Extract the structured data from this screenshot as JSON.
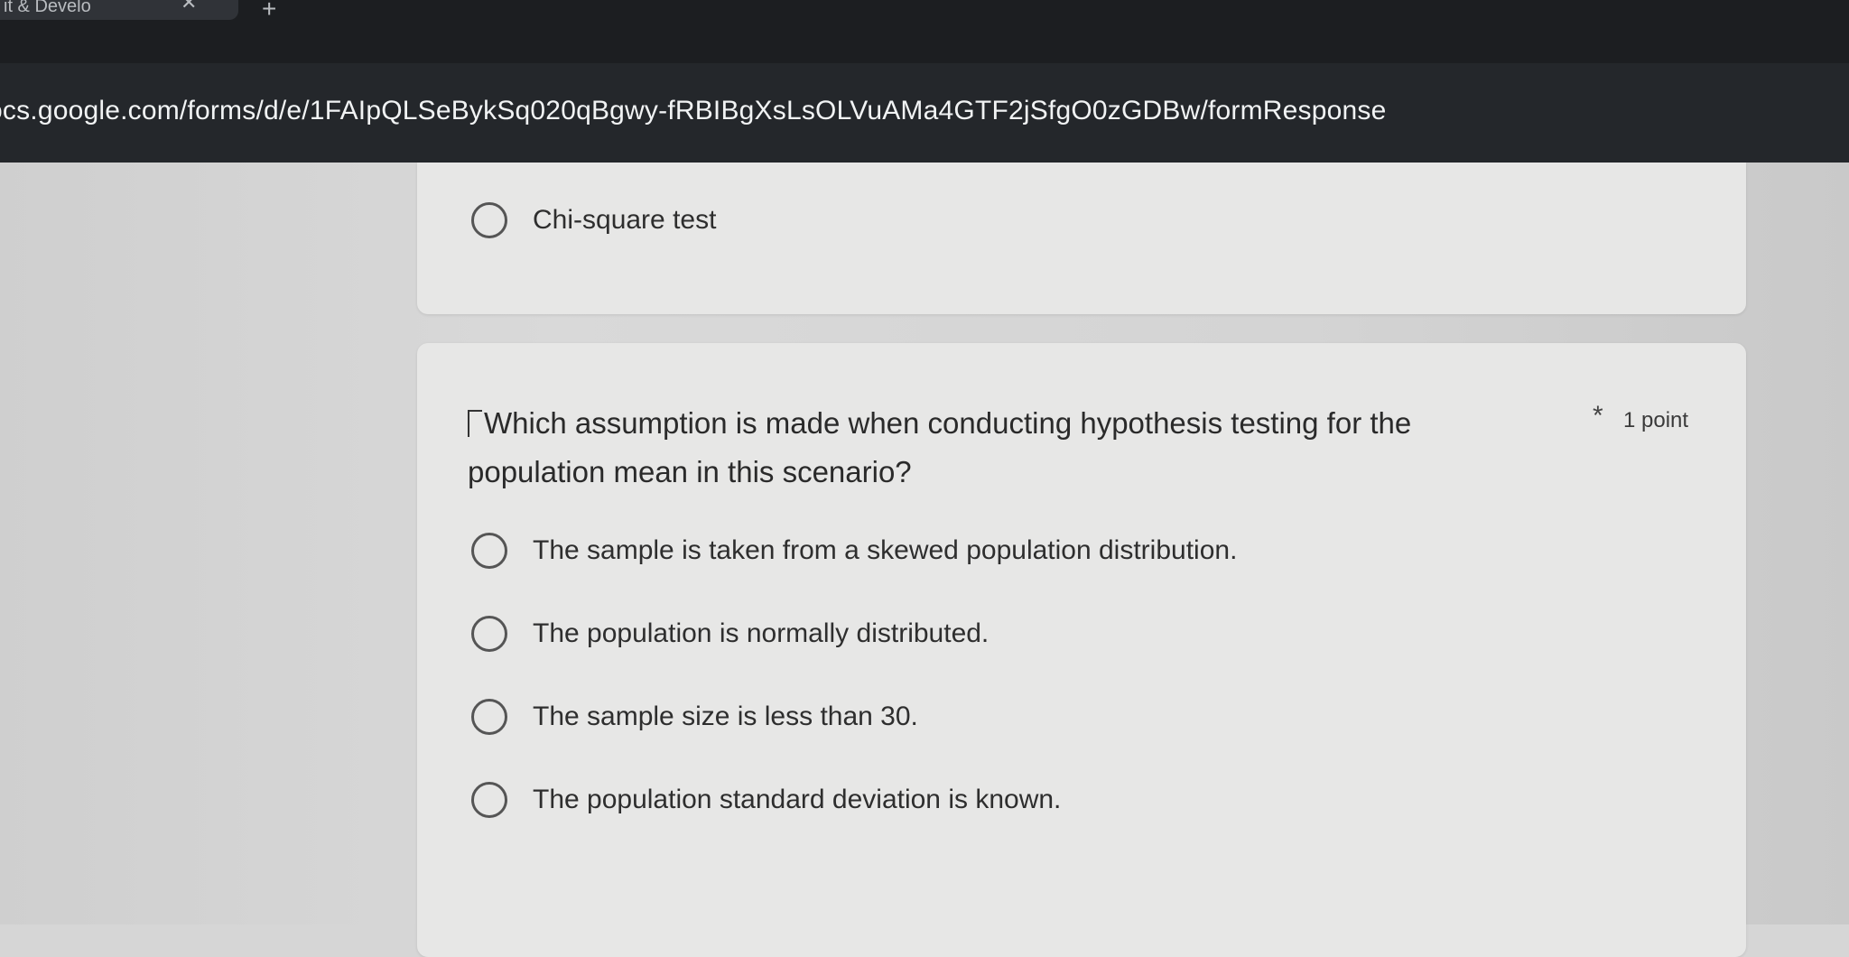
{
  "browser": {
    "tab_title": "it & Develo",
    "tab_close": "✕",
    "new_tab": "+",
    "url": "ocs.google.com/forms/d/e/1FAIpQLSeBykSq020qBgwy-fRBIBgXsLsOLVuAMa4GTF2jSfgO0zGDBw/formResponse"
  },
  "previous_question": {
    "options": [
      {
        "label": "Chi-square test"
      }
    ]
  },
  "question": {
    "title": "Which assumption is made when conducting hypothesis testing for the population mean in this scenario?",
    "required_marker": "*",
    "points": "1 point",
    "options": [
      {
        "label": "The sample is taken from a skewed population distribution."
      },
      {
        "label": "The population is normally distributed."
      },
      {
        "label": "The sample size is less than 30."
      },
      {
        "label": "The population standard deviation is known."
      }
    ]
  }
}
